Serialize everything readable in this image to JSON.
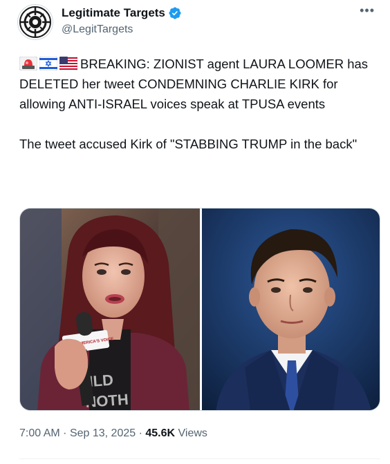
{
  "author": {
    "display_name": "Legitimate Targets",
    "handle": "@LegitTargets",
    "verified": true
  },
  "icons": {
    "more": "more-options-icon",
    "verified": "verified-badge-icon",
    "siren": "police-siren-emoji-icon",
    "flag_israel": "israel-flag-emoji-icon",
    "flag_us": "us-flag-emoji-icon"
  },
  "tweet": {
    "paragraph_1": "BREAKING: ZIONIST agent LAURA LOOMER has DELETED her tweet CONDEMNING CHARLIE KIRK for allowing ANTI-ISRAEL voices speak at TPUSA events",
    "paragraph_2": "The tweet accused Kirk of \"STABBING TRUMP in the back\""
  },
  "media": {
    "left_photo": {
      "mic_flag_text_1": "REAL AMERICA'S VOICE",
      "mic_flag_text_2": "REAL AMERICA'S VOICE",
      "shirt_text_1": "ILD",
      "shirt_text_2": "NOTH"
    }
  },
  "meta": {
    "time": "7:00 AM",
    "separator": "·",
    "date": "Sep 13, 2025",
    "views_count": "45.6K",
    "views_label": "Views"
  },
  "colors": {
    "verified_blue": "#1d9bf0",
    "text_primary": "#0f1419",
    "text_secondary": "#536471"
  }
}
